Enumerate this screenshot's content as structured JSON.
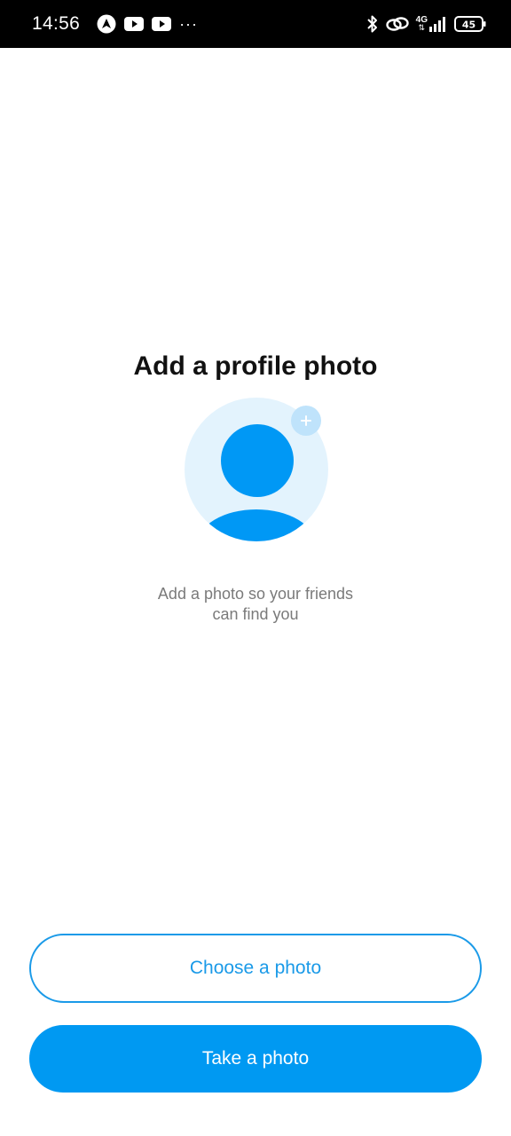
{
  "status_bar": {
    "time": "14:56",
    "network": "4G",
    "battery": "45",
    "more": "···",
    "icons": [
      "navigation-app-icon",
      "youtube-icon",
      "youtube-icon",
      "more-dots-icon",
      "bluetooth-icon",
      "link-icon",
      "signal-icon",
      "battery-icon"
    ]
  },
  "main": {
    "title": "Add a profile photo",
    "subtitle_line1": "Add a photo so your friends",
    "subtitle_line2": "can find you",
    "avatar": {
      "icons": [
        "avatar-placeholder-icon",
        "plus-icon"
      ]
    }
  },
  "actions": {
    "choose_label": "Choose a photo",
    "take_label": "Take a photo"
  },
  "colors": {
    "accent": "#0099f2",
    "avatar_bg": "#e3f3fd",
    "badge_bg": "#bfe3fb",
    "subtitle": "#7a7a7a"
  }
}
